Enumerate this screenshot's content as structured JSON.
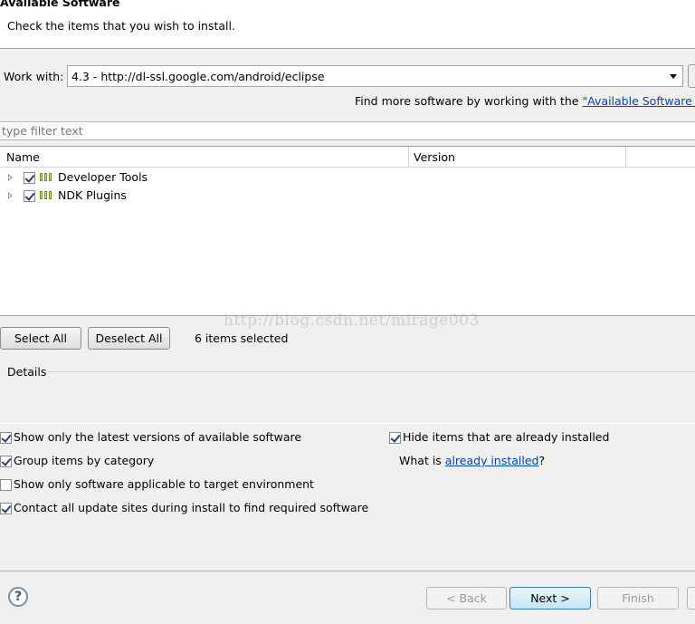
{
  "header": {
    "title": "Available Software",
    "description": "Check the items that you wish to install."
  },
  "work_with": {
    "label": "Work with:",
    "value": "4.3 - http://dl-ssl.google.com/android/eclipse"
  },
  "find_more": {
    "prefix": "Find more software by working with the ",
    "link": "\"Available Software Sites"
  },
  "filter": {
    "placeholder": "type filter text"
  },
  "table": {
    "columns": [
      "Name",
      "Version"
    ],
    "rows": [
      {
        "label": "Developer Tools",
        "checked": true
      },
      {
        "label": "NDK Plugins",
        "checked": true
      }
    ]
  },
  "buttons": {
    "select_all": "Select All",
    "deselect_all": "Deselect All",
    "selected_count": "6 items selected"
  },
  "details": {
    "label": "Details"
  },
  "options": {
    "latest_versions": "Show only the latest versions of available software",
    "group_by_category": "Group items by category",
    "target_environment": "Show only software applicable to target environment",
    "contact_sites": "Contact all update sites during install to find required software",
    "hide_installed": "Hide items that are already installed",
    "what_is_prefix": "What is ",
    "already_installed_link": "already installed",
    "what_is_suffix": "?"
  },
  "option_states": {
    "latest_versions": true,
    "group_by_category": true,
    "target_environment": false,
    "contact_sites": true,
    "hide_installed": true
  },
  "footer": {
    "help_glyph": "?",
    "back": "< Back",
    "next": "Next >",
    "finish": "Finish"
  },
  "watermark": "http://blog.csdn.net/mirage003"
}
